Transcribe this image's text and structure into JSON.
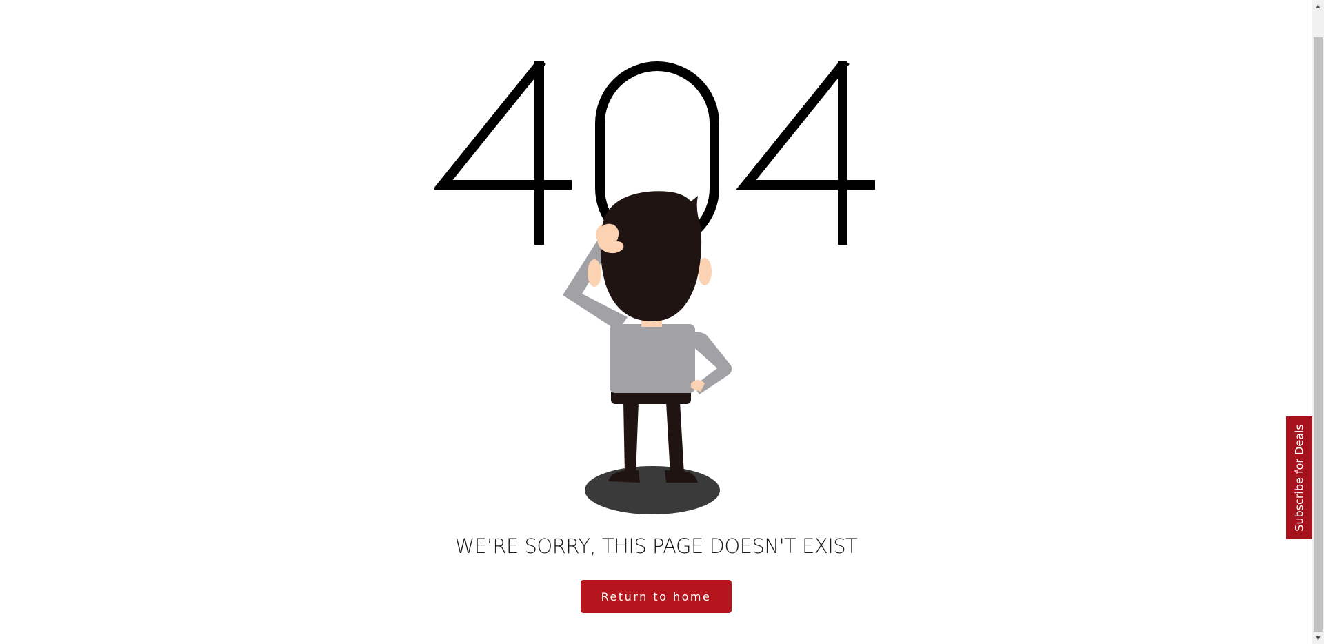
{
  "error": {
    "code": "404",
    "message": "WE’RE SORRY, THIS PAGE DOESN'T EXIST"
  },
  "actions": {
    "return_home_label": "Return to home"
  },
  "subscribe_tab": {
    "label": "Subscribe for Deals"
  },
  "colors": {
    "accent": "#b5161d",
    "subscribe_tab": "#a5121c",
    "text": "#1d1d1d",
    "hair": "#201412",
    "shirt": "#a2a2a6",
    "skin": "#fbd3b3",
    "shadow": "#3a3a3a"
  },
  "icons": {
    "scroll_up": "triangle-up-icon",
    "scroll_down": "triangle-down-icon"
  }
}
